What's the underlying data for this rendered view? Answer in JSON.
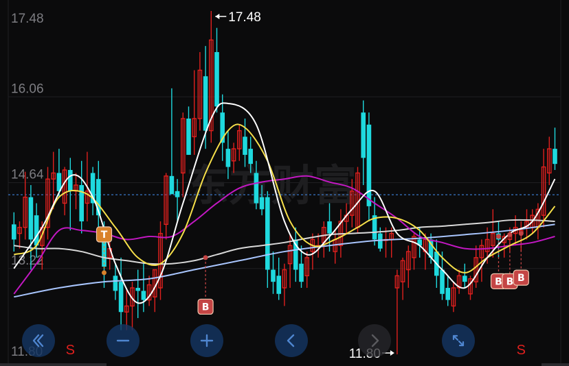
{
  "chart_data": {
    "type": "candlestick",
    "price_labels": [
      "17.48",
      "16.06",
      "14.64",
      "13.22",
      "11.80"
    ],
    "ylim": [
      11.8,
      17.48
    ],
    "current_price_line": 14.44,
    "max_price": 17.48,
    "min_price": 11.8,
    "max_label": "17.48",
    "min_label": "11.80",
    "colors": {
      "up": "#e0201e",
      "down": "#1fd9de",
      "ma5": "#ffffff",
      "ma10": "#f7e04a",
      "ma20": "#c318c3",
      "ma60": "#d9d9d9",
      "ma120": "#a9c6ff"
    },
    "candles": [
      [
        13.95,
        14.15,
        13.5,
        13.7
      ],
      [
        13.8,
        14.0,
        13.55,
        13.9
      ],
      [
        13.9,
        14.82,
        13.7,
        14.4
      ],
      [
        14.4,
        14.6,
        13.2,
        13.7
      ],
      [
        14.1,
        14.3,
        13.4,
        13.6
      ],
      [
        13.6,
        14.0,
        13.2,
        13.9
      ],
      [
        13.9,
        14.9,
        13.7,
        14.7
      ],
      [
        14.7,
        15.15,
        14.2,
        14.8
      ],
      [
        14.8,
        15.2,
        14.4,
        14.5
      ],
      [
        14.3,
        14.9,
        14.1,
        14.85
      ],
      [
        14.85,
        15.05,
        13.85,
        14.5
      ],
      [
        14.5,
        14.8,
        14.2,
        14.6
      ],
      [
        14.6,
        15.0,
        13.8,
        14.0
      ],
      [
        14.3,
        15.15,
        14.0,
        14.5
      ],
      [
        14.8,
        14.9,
        14.1,
        14.3
      ],
      [
        14.7,
        15.0,
        13.8,
        14.1
      ],
      [
        13.9,
        14.0,
        12.9,
        13.25
      ],
      [
        13.4,
        13.7,
        13.2,
        13.55
      ],
      [
        13.1,
        13.3,
        12.7,
        12.85
      ],
      [
        13.0,
        13.4,
        12.2,
        12.5
      ],
      [
        12.5,
        12.9,
        12.2,
        12.6
      ],
      [
        12.6,
        13.0,
        12.2,
        12.9
      ],
      [
        12.9,
        13.2,
        12.4,
        12.85
      ],
      [
        12.85,
        13.3,
        12.5,
        12.7
      ],
      [
        12.7,
        13.1,
        12.6,
        12.95
      ],
      [
        12.75,
        13.2,
        12.5,
        13.2
      ],
      [
        12.9,
        14.0,
        12.7,
        13.8
      ],
      [
        13.95,
        14.8,
        13.7,
        14.75
      ],
      [
        14.75,
        16.2,
        14.45,
        14.45
      ],
      [
        14.5,
        14.7,
        14.0,
        14.4
      ],
      [
        14.8,
        15.8,
        14.4,
        15.7
      ],
      [
        15.7,
        15.9,
        15.1,
        15.1
      ],
      [
        15.4,
        16.5,
        15.1,
        15.7
      ],
      [
        15.7,
        16.8,
        15.5,
        16.5
      ],
      [
        16.4,
        16.9,
        15.2,
        15.5
      ],
      [
        15.5,
        17.48,
        15.3,
        17.0
      ],
      [
        16.8,
        17.2,
        15.8,
        15.9
      ],
      [
        15.8,
        16.1,
        15.0,
        15.3
      ],
      [
        15.2,
        15.5,
        14.7,
        14.9
      ],
      [
        15.0,
        15.3,
        14.8,
        15.2
      ],
      [
        15.2,
        15.6,
        15.0,
        15.5
      ],
      [
        15.4,
        15.7,
        14.9,
        15.1
      ],
      [
        15.2,
        15.4,
        14.8,
        14.95
      ],
      [
        14.8,
        15.0,
        14.2,
        14.3
      ],
      [
        14.4,
        14.6,
        14.1,
        14.2
      ],
      [
        14.4,
        14.5,
        12.9,
        13.2
      ],
      [
        13.2,
        13.5,
        12.8,
        13.0
      ],
      [
        13.1,
        13.4,
        12.7,
        12.8
      ],
      [
        12.9,
        13.3,
        12.6,
        13.2
      ],
      [
        13.3,
        13.8,
        12.9,
        13.6
      ],
      [
        13.7,
        13.9,
        13.0,
        13.2
      ],
      [
        13.3,
        13.6,
        12.9,
        13.0
      ],
      [
        13.1,
        13.5,
        12.9,
        13.4
      ],
      [
        13.5,
        13.8,
        13.2,
        13.7
      ],
      [
        13.6,
        13.8,
        13.4,
        13.6
      ],
      [
        13.65,
        14.0,
        13.4,
        13.9
      ],
      [
        14.0,
        14.3,
        13.5,
        13.8
      ],
      [
        13.5,
        13.85,
        13.3,
        13.7
      ],
      [
        13.6,
        14.2,
        13.4,
        14.0
      ],
      [
        14.0,
        14.3,
        13.8,
        14.1
      ],
      [
        14.1,
        14.7,
        13.9,
        14.5
      ],
      [
        13.9,
        14.9,
        13.8,
        14.8
      ],
      [
        15.8,
        16.0,
        14.6,
        15.05
      ],
      [
        15.6,
        15.8,
        14.0,
        14.25
      ],
      [
        14.1,
        14.4,
        13.6,
        13.7
      ],
      [
        13.8,
        13.9,
        13.5,
        13.55
      ],
      [
        13.7,
        13.9,
        13.4,
        13.7
      ],
      [
        13.7,
        13.9,
        13.4,
        13.8
      ],
      [
        12.9,
        13.2,
        11.8,
        13.1
      ],
      [
        13.0,
        13.4,
        12.7,
        13.35
      ],
      [
        13.2,
        13.6,
        12.9,
        13.5
      ],
      [
        13.4,
        13.8,
        13.2,
        13.75
      ],
      [
        13.7,
        13.9,
        13.4,
        13.6
      ],
      [
        13.5,
        13.8,
        13.2,
        13.7
      ],
      [
        13.7,
        13.8,
        13.3,
        13.4
      ],
      [
        13.5,
        13.7,
        12.9,
        13.1
      ],
      [
        13.2,
        13.5,
        12.7,
        12.8
      ],
      [
        12.9,
        13.1,
        12.6,
        12.7
      ],
      [
        12.6,
        13.0,
        12.5,
        12.9
      ],
      [
        12.9,
        13.2,
        12.8,
        13.1
      ],
      [
        13.1,
        13.3,
        12.9,
        13.0
      ],
      [
        12.8,
        13.1,
        12.7,
        13.05
      ],
      [
        13.0,
        13.6,
        12.9,
        13.4
      ],
      [
        13.4,
        13.7,
        13.0,
        13.6
      ],
      [
        13.5,
        13.9,
        13.3,
        13.7
      ],
      [
        13.6,
        14.2,
        13.4,
        13.8
      ],
      [
        13.8,
        14.0,
        13.4,
        13.7
      ],
      [
        13.65,
        13.8,
        13.4,
        13.75
      ],
      [
        13.7,
        13.9,
        13.5,
        13.8
      ],
      [
        13.8,
        14.1,
        13.6,
        13.9
      ],
      [
        13.8,
        14.0,
        13.5,
        13.85
      ],
      [
        13.9,
        14.2,
        13.7,
        14.0
      ],
      [
        13.9,
        14.2,
        13.8,
        14.1
      ],
      [
        13.9,
        14.3,
        13.7,
        14.2
      ],
      [
        14.1,
        15.2,
        13.9,
        14.9
      ],
      [
        14.8,
        15.4,
        14.6,
        15.2
      ],
      [
        15.2,
        15.55,
        14.85,
        14.95
      ]
    ],
    "ma_lines": [
      {
        "name": "ma5",
        "color": "#ffffff",
        "points": [
          [
            0,
            13.22
          ],
          [
            5,
            13.9
          ],
          [
            10,
            14.75
          ],
          [
            14,
            14.4
          ],
          [
            18,
            13.3
          ],
          [
            22,
            12.65
          ],
          [
            26,
            13.1
          ],
          [
            30,
            14.3
          ],
          [
            35,
            15.7
          ],
          [
            38,
            15.95
          ],
          [
            43,
            15.6
          ],
          [
            48,
            14.0
          ],
          [
            52,
            13.45
          ],
          [
            56,
            13.75
          ],
          [
            60,
            14.2
          ],
          [
            64,
            14.5
          ],
          [
            68,
            13.8
          ],
          [
            72,
            13.6
          ],
          [
            76,
            13.2
          ],
          [
            80,
            12.9
          ],
          [
            84,
            13.4
          ],
          [
            88,
            13.8
          ],
          [
            92,
            14.0
          ],
          [
            96,
            14.7
          ]
        ]
      },
      {
        "name": "ma10",
        "color": "#f7e04a",
        "points": [
          [
            0,
            13.45
          ],
          [
            4,
            13.6
          ],
          [
            8,
            14.4
          ],
          [
            13,
            14.45
          ],
          [
            18,
            13.9
          ],
          [
            22,
            13.4
          ],
          [
            26,
            13.3
          ],
          [
            30,
            13.8
          ],
          [
            34,
            14.8
          ],
          [
            38,
            15.5
          ],
          [
            41,
            15.55
          ],
          [
            45,
            15.0
          ],
          [
            49,
            14.0
          ],
          [
            53,
            13.6
          ],
          [
            57,
            13.7
          ],
          [
            61,
            13.9
          ],
          [
            64,
            14.05
          ],
          [
            68,
            14.05
          ],
          [
            72,
            13.85
          ],
          [
            76,
            13.4
          ],
          [
            80,
            13.15
          ],
          [
            84,
            13.4
          ],
          [
            88,
            13.6
          ],
          [
            92,
            13.8
          ],
          [
            96,
            14.25
          ]
        ]
      },
      {
        "name": "ma20",
        "color": "#c318c3",
        "points": [
          [
            0,
            12.8
          ],
          [
            4,
            13.3
          ],
          [
            8,
            13.85
          ],
          [
            12,
            13.85
          ],
          [
            16,
            13.8
          ],
          [
            20,
            13.7
          ],
          [
            24,
            13.75
          ],
          [
            28,
            13.75
          ],
          [
            32,
            14.0
          ],
          [
            36,
            14.3
          ],
          [
            40,
            14.55
          ],
          [
            44,
            14.65
          ],
          [
            48,
            14.7
          ],
          [
            52,
            14.75
          ],
          [
            56,
            14.65
          ],
          [
            60,
            14.55
          ],
          [
            64,
            14.3
          ],
          [
            68,
            14.05
          ],
          [
            72,
            13.75
          ],
          [
            76,
            13.65
          ],
          [
            80,
            13.55
          ],
          [
            84,
            13.55
          ],
          [
            88,
            13.6
          ],
          [
            92,
            13.65
          ],
          [
            96,
            13.75
          ]
        ]
      },
      {
        "name": "ma60",
        "color": "#d9d9d9",
        "points": [
          [
            0,
            13.6
          ],
          [
            4,
            13.55
          ],
          [
            8,
            13.55
          ],
          [
            12,
            13.5
          ],
          [
            16,
            13.4
          ],
          [
            20,
            13.35
          ],
          [
            24,
            13.3
          ],
          [
            28,
            13.3
          ],
          [
            32,
            13.35
          ],
          [
            36,
            13.45
          ],
          [
            40,
            13.55
          ],
          [
            44,
            13.6
          ],
          [
            48,
            13.65
          ],
          [
            52,
            13.72
          ],
          [
            56,
            13.78
          ],
          [
            60,
            13.8
          ],
          [
            64,
            13.82
          ],
          [
            68,
            13.85
          ],
          [
            72,
            13.9
          ],
          [
            76,
            13.92
          ],
          [
            80,
            13.95
          ],
          [
            84,
            13.98
          ],
          [
            88,
            14.02
          ],
          [
            92,
            14.02
          ],
          [
            96,
            14.0
          ]
        ]
      },
      {
        "name": "ma120",
        "color": "#a9c6ff",
        "points": [
          [
            0,
            12.75
          ],
          [
            8,
            12.9
          ],
          [
            16,
            13.0
          ],
          [
            24,
            13.05
          ],
          [
            32,
            13.2
          ],
          [
            40,
            13.35
          ],
          [
            48,
            13.5
          ],
          [
            56,
            13.6
          ],
          [
            64,
            13.68
          ],
          [
            72,
            13.72
          ],
          [
            80,
            13.78
          ],
          [
            88,
            13.85
          ],
          [
            96,
            13.95
          ]
        ]
      }
    ],
    "signals": [
      {
        "label": "T",
        "index": 16,
        "price": 13.75,
        "marker": 13.15,
        "color": "#d9822b"
      },
      {
        "label": "B",
        "index": 34,
        "price": 12.6,
        "marker": 13.4,
        "color": "#c44545"
      },
      {
        "label": "B",
        "index": 86,
        "price": 13.02,
        "marker": 13.75,
        "color": "#c44545"
      },
      {
        "label": "B",
        "index": 88,
        "price": 13.02,
        "marker": 13.78,
        "color": "#c44545"
      },
      {
        "label": "B",
        "index": 90,
        "price": 13.08,
        "marker": 13.8,
        "color": "#c44545"
      }
    ],
    "sell_marks": [
      {
        "label": "S",
        "index": 10
      },
      {
        "label": "S",
        "index": 90
      }
    ],
    "watermark": "东方财富"
  },
  "controls": [
    {
      "name": "scroll-far-left-button",
      "icon": "double-chevron-left-icon",
      "label": "«"
    },
    {
      "name": "zoom-out-button",
      "icon": "minus-icon",
      "label": "−"
    },
    {
      "name": "zoom-in-button",
      "icon": "plus-icon",
      "label": "+"
    },
    {
      "name": "scroll-left-button",
      "icon": "chevron-left-icon",
      "label": "‹"
    },
    {
      "name": "scroll-right-button",
      "icon": "chevron-right-icon",
      "label": "›"
    },
    {
      "name": "fullscreen-button",
      "icon": "expand-icon",
      "label": "⤢"
    }
  ]
}
